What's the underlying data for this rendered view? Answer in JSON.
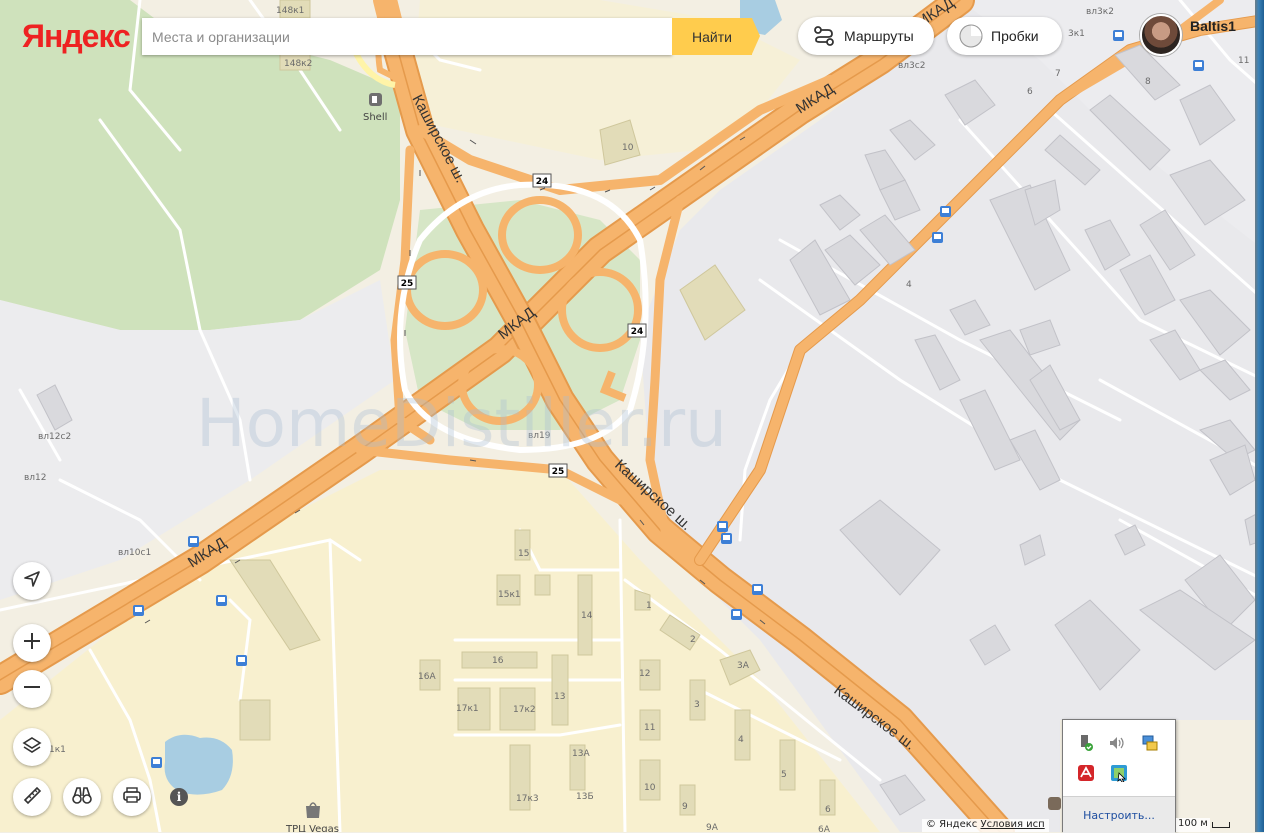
{
  "header": {
    "logo": "Яндекс",
    "search_placeholder": "Места и организации",
    "find_label": "Найти",
    "routes_label": "Маршруты",
    "traffic_label": "Пробки",
    "user_name": "Baltis1"
  },
  "map": {
    "road_labels": [
      "МКАД",
      "МКАД",
      "МКАД",
      "Каширское ш.",
      "Каширское ш.",
      "Каширское ш."
    ],
    "exit_numbers": [
      "24",
      "24",
      "25",
      "25"
    ],
    "poi": {
      "shell": "Shell",
      "tpu": "ТРЦ Vegas"
    },
    "buildings": [
      "148к1",
      "148к2",
      "10",
      "вл3с2",
      "6",
      "7",
      "8",
      "3к1",
      "вл3к2",
      "11",
      "4",
      "вл12с2",
      "вл12",
      "вл10с1",
      "вл19",
      "15",
      "15к1",
      "14",
      "16",
      "16А",
      "17к1",
      "17к2",
      "13",
      "13А",
      "13Б",
      "17к3",
      "1",
      "2",
      "3А",
      "12",
      "11",
      "3",
      "4",
      "5",
      "10",
      "9",
      "6",
      "9А",
      "6А",
      "1к1"
    ],
    "watermark": "HomeDistiller.ru"
  },
  "controls": {
    "locate": "locate-icon",
    "zoom_in": "+",
    "zoom_out": "−",
    "layers": "layers-icon",
    "ruler": "ruler-icon",
    "panorama": "binoculars-icon",
    "print": "printer-icon",
    "info": "i"
  },
  "tray": {
    "configure_label": "Настроить..."
  },
  "footer": {
    "copyright": "© Яндекс",
    "terms": "Условия исп",
    "scale": "100 м"
  },
  "colors": {
    "road": "#f6b46c",
    "road_edge": "#e69646",
    "green": "#d4e4c3",
    "residential": "#f7eecb",
    "industrial": "#e8e8ea",
    "search_button": "#ffcc4d"
  }
}
